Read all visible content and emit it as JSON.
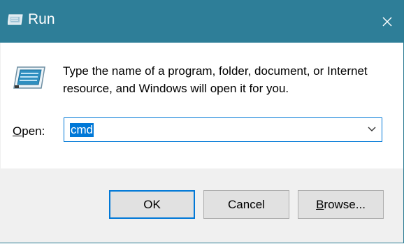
{
  "window": {
    "title": "Run",
    "title_icon": "run-icon",
    "close_icon": "close-icon",
    "accent_color": "#2e7e98"
  },
  "body": {
    "description": "Type the name of a program, folder, document, or Internet resource, and Windows will open it for you.",
    "open_label_underlined": "O",
    "open_label_rest": "pen:",
    "input_value": "cmd"
  },
  "buttons": {
    "ok_label": "OK",
    "cancel_label": "Cancel",
    "browse_label_underlined": "B",
    "browse_label_rest": "rowse..."
  }
}
